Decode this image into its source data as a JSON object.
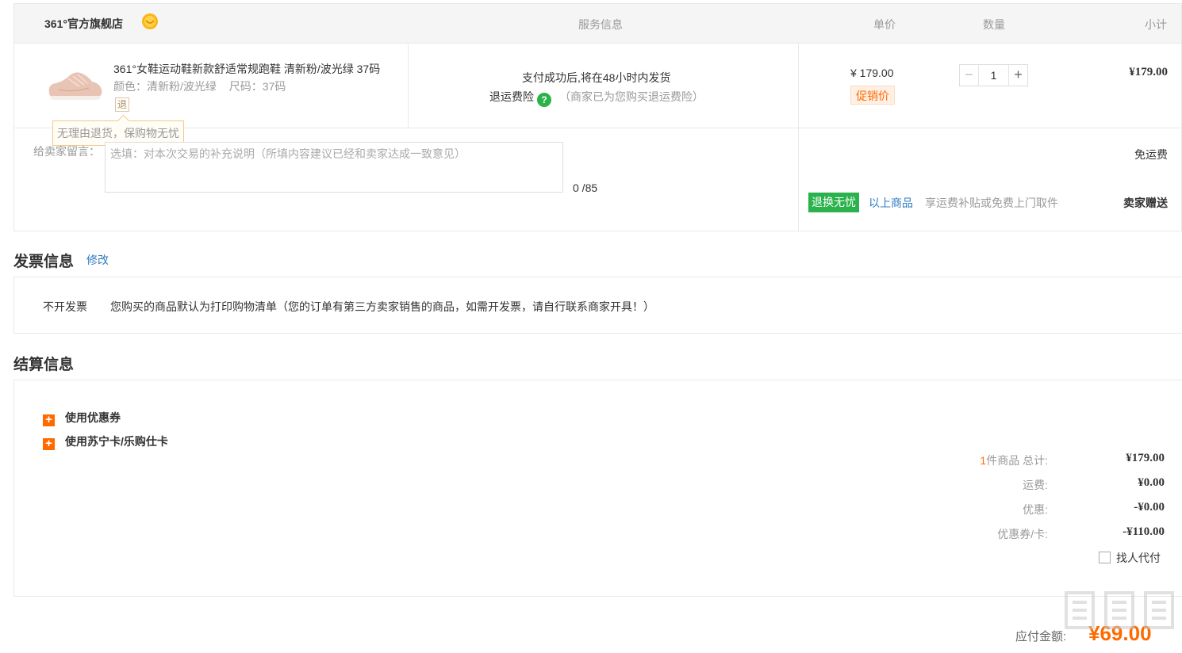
{
  "store": {
    "name": "361°官方旗舰店",
    "columns": {
      "service": "服务信息",
      "unit_price": "单价",
      "quantity": "数量",
      "subtotal": "小计"
    }
  },
  "product": {
    "title": "361°女鞋运动鞋新款舒适常规跑鞋 清新粉/波光绿 37码",
    "color_label": "颜色：清新粉/波光绿",
    "size_label": "尺码：37码",
    "return_tag": "退",
    "return_tip": "无理由退货，保购物无忧",
    "service_line1": "支付成功后,将在48小时内发货",
    "service_insurance": "退运费险",
    "service_help_icon": "?",
    "service_note": "（商家已为您购买退运费险）",
    "unit_price": "¥ 179.00",
    "promo_tag": "促销价",
    "quantity": "1",
    "qty_minus": "−",
    "qty_plus": "+",
    "subtotal": "¥179.00"
  },
  "message": {
    "label": "给卖家留言：",
    "placeholder": "选填：对本次交易的补充说明（所填内容建议已经和卖家达成一致意见）",
    "counter": "0 /85"
  },
  "shipping": {
    "free": "免运费",
    "tag": "退换无忧",
    "above_items": "以上商品",
    "desc": "享运费补贴或免费上门取件",
    "seller_gift": "卖家赠送"
  },
  "invoice": {
    "title": "发票信息",
    "edit": "修改",
    "type": "不开发票",
    "desc": "您购买的商品默认为打印购物清单（您的订单有第三方卖家销售的商品，如需开发票，请自行联系商家开具！）"
  },
  "settlement": {
    "title": "结算信息",
    "use_coupon": "使用优惠券",
    "use_card": "使用苏宁卡/乐购仕卡",
    "count_num": "1",
    "count_label": "件商品 总计:",
    "total": "¥179.00",
    "freight_label": "运费:",
    "freight": "¥0.00",
    "discount_label": "优惠:",
    "discount": "-¥0.00",
    "coupon_label": "优惠券/卡:",
    "coupon": "-¥110.00",
    "pay_for_other": "找人代付"
  },
  "payment": {
    "label": "应付金额:",
    "amount": "¥69.00"
  },
  "colors": {
    "accent": "#ff6a00",
    "link": "#2f7cc2",
    "green": "#2bb24c"
  },
  "icons": {
    "store_badge": "smile-badge-icon",
    "product_image": "pink-running-shoe",
    "help": "question-circle-icon",
    "expand": "plus-square-icon"
  }
}
